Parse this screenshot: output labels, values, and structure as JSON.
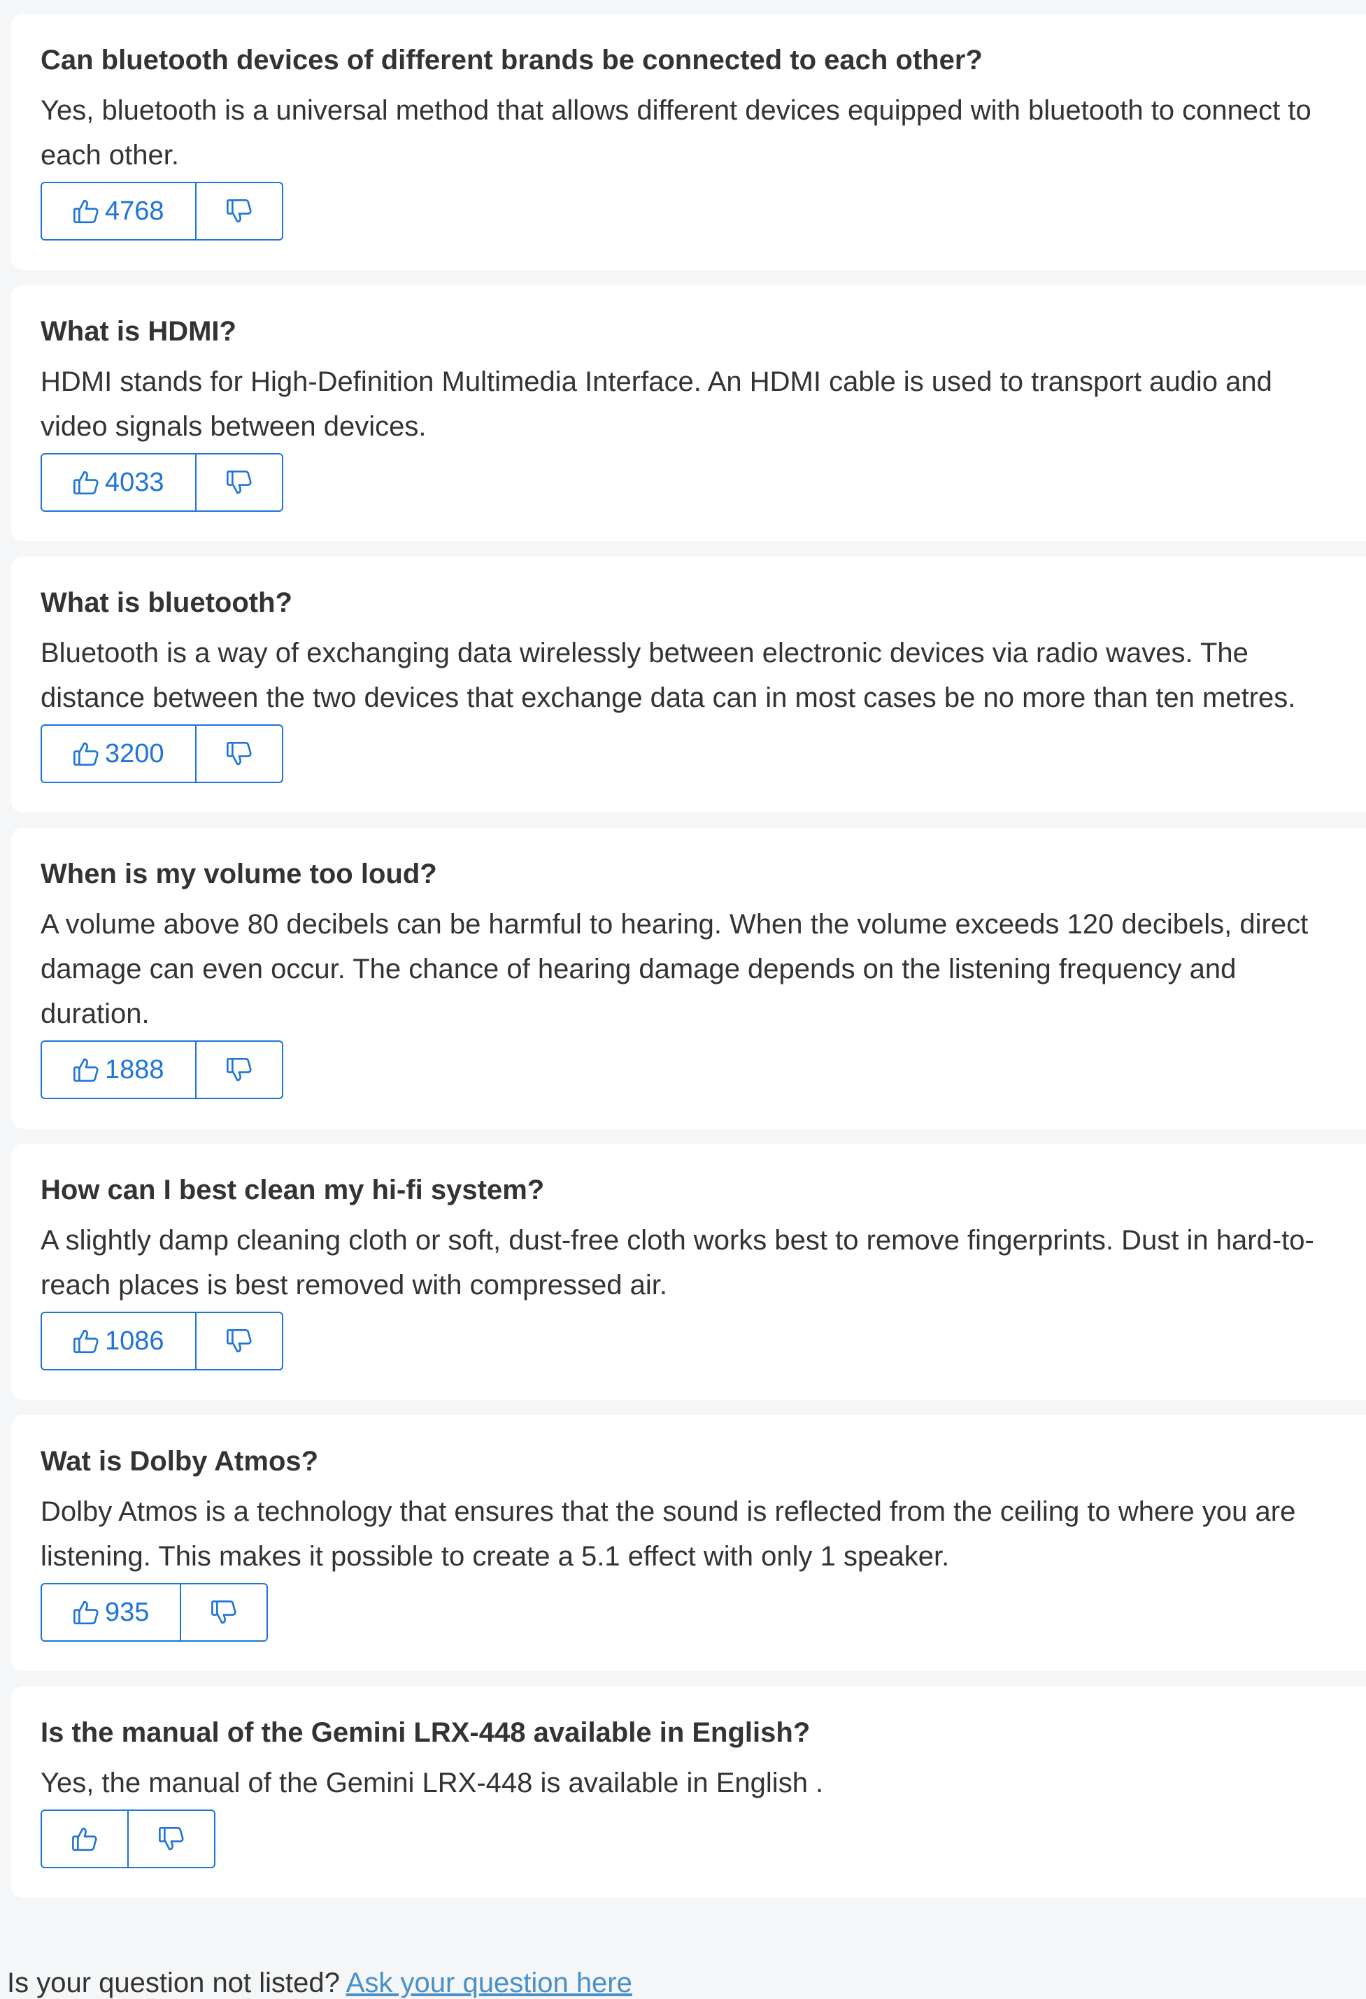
{
  "colors": {
    "background": "#f4f6f7",
    "card": "#ffffff",
    "accent": "#1e74d8",
    "link": "#4a90c8",
    "text": "#333333"
  },
  "icons": {
    "vote_up": "thumbs-up-icon",
    "vote_down": "thumbs-down-icon"
  },
  "faqs": [
    {
      "question": "Can bluetooth devices of different brands be connected to each other?",
      "answer": "Yes, bluetooth is a universal method that allows different devices equipped with bluetooth to connect to each other.",
      "upvotes": "4768"
    },
    {
      "question": "What is HDMI?",
      "answer": "HDMI stands for High-Definition Multimedia Interface. An HDMI cable is used to transport audio and video signals between devices.",
      "upvotes": "4033"
    },
    {
      "question": "What is bluetooth?",
      "answer": "Bluetooth is a way of exchanging data wirelessly between electronic devices via radio waves. The distance between the two devices that exchange data can in most cases be no more than ten metres.",
      "upvotes": "3200"
    },
    {
      "question": "When is my volume too loud?",
      "answer": "A volume above 80 decibels can be harmful to hearing. When the volume exceeds 120 decibels, direct damage can even occur. The chance of hearing damage depends on the listening frequency and duration.",
      "upvotes": "1888"
    },
    {
      "question": "How can I best clean my hi-fi system?",
      "answer": "A slightly damp cleaning cloth or soft, dust-free cloth works best to remove fingerprints. Dust in hard-to-reach places is best removed with compressed air.",
      "upvotes": "1086"
    },
    {
      "question": "Wat is Dolby Atmos?",
      "answer": "Dolby Atmos is a technology that ensures that the sound is reflected from the ceiling to where you are listening. This makes it possible to create a 5.1 effect with only 1 speaker.",
      "upvotes": "935"
    },
    {
      "question": "Is the manual of the Gemini LRX-448 available in English?",
      "answer": "Yes, the manual of the Gemini LRX-448 is available in English .",
      "upvotes": ""
    }
  ],
  "footer": {
    "prompt": "Is your question not listed?",
    "link_label": "Ask your question here"
  }
}
